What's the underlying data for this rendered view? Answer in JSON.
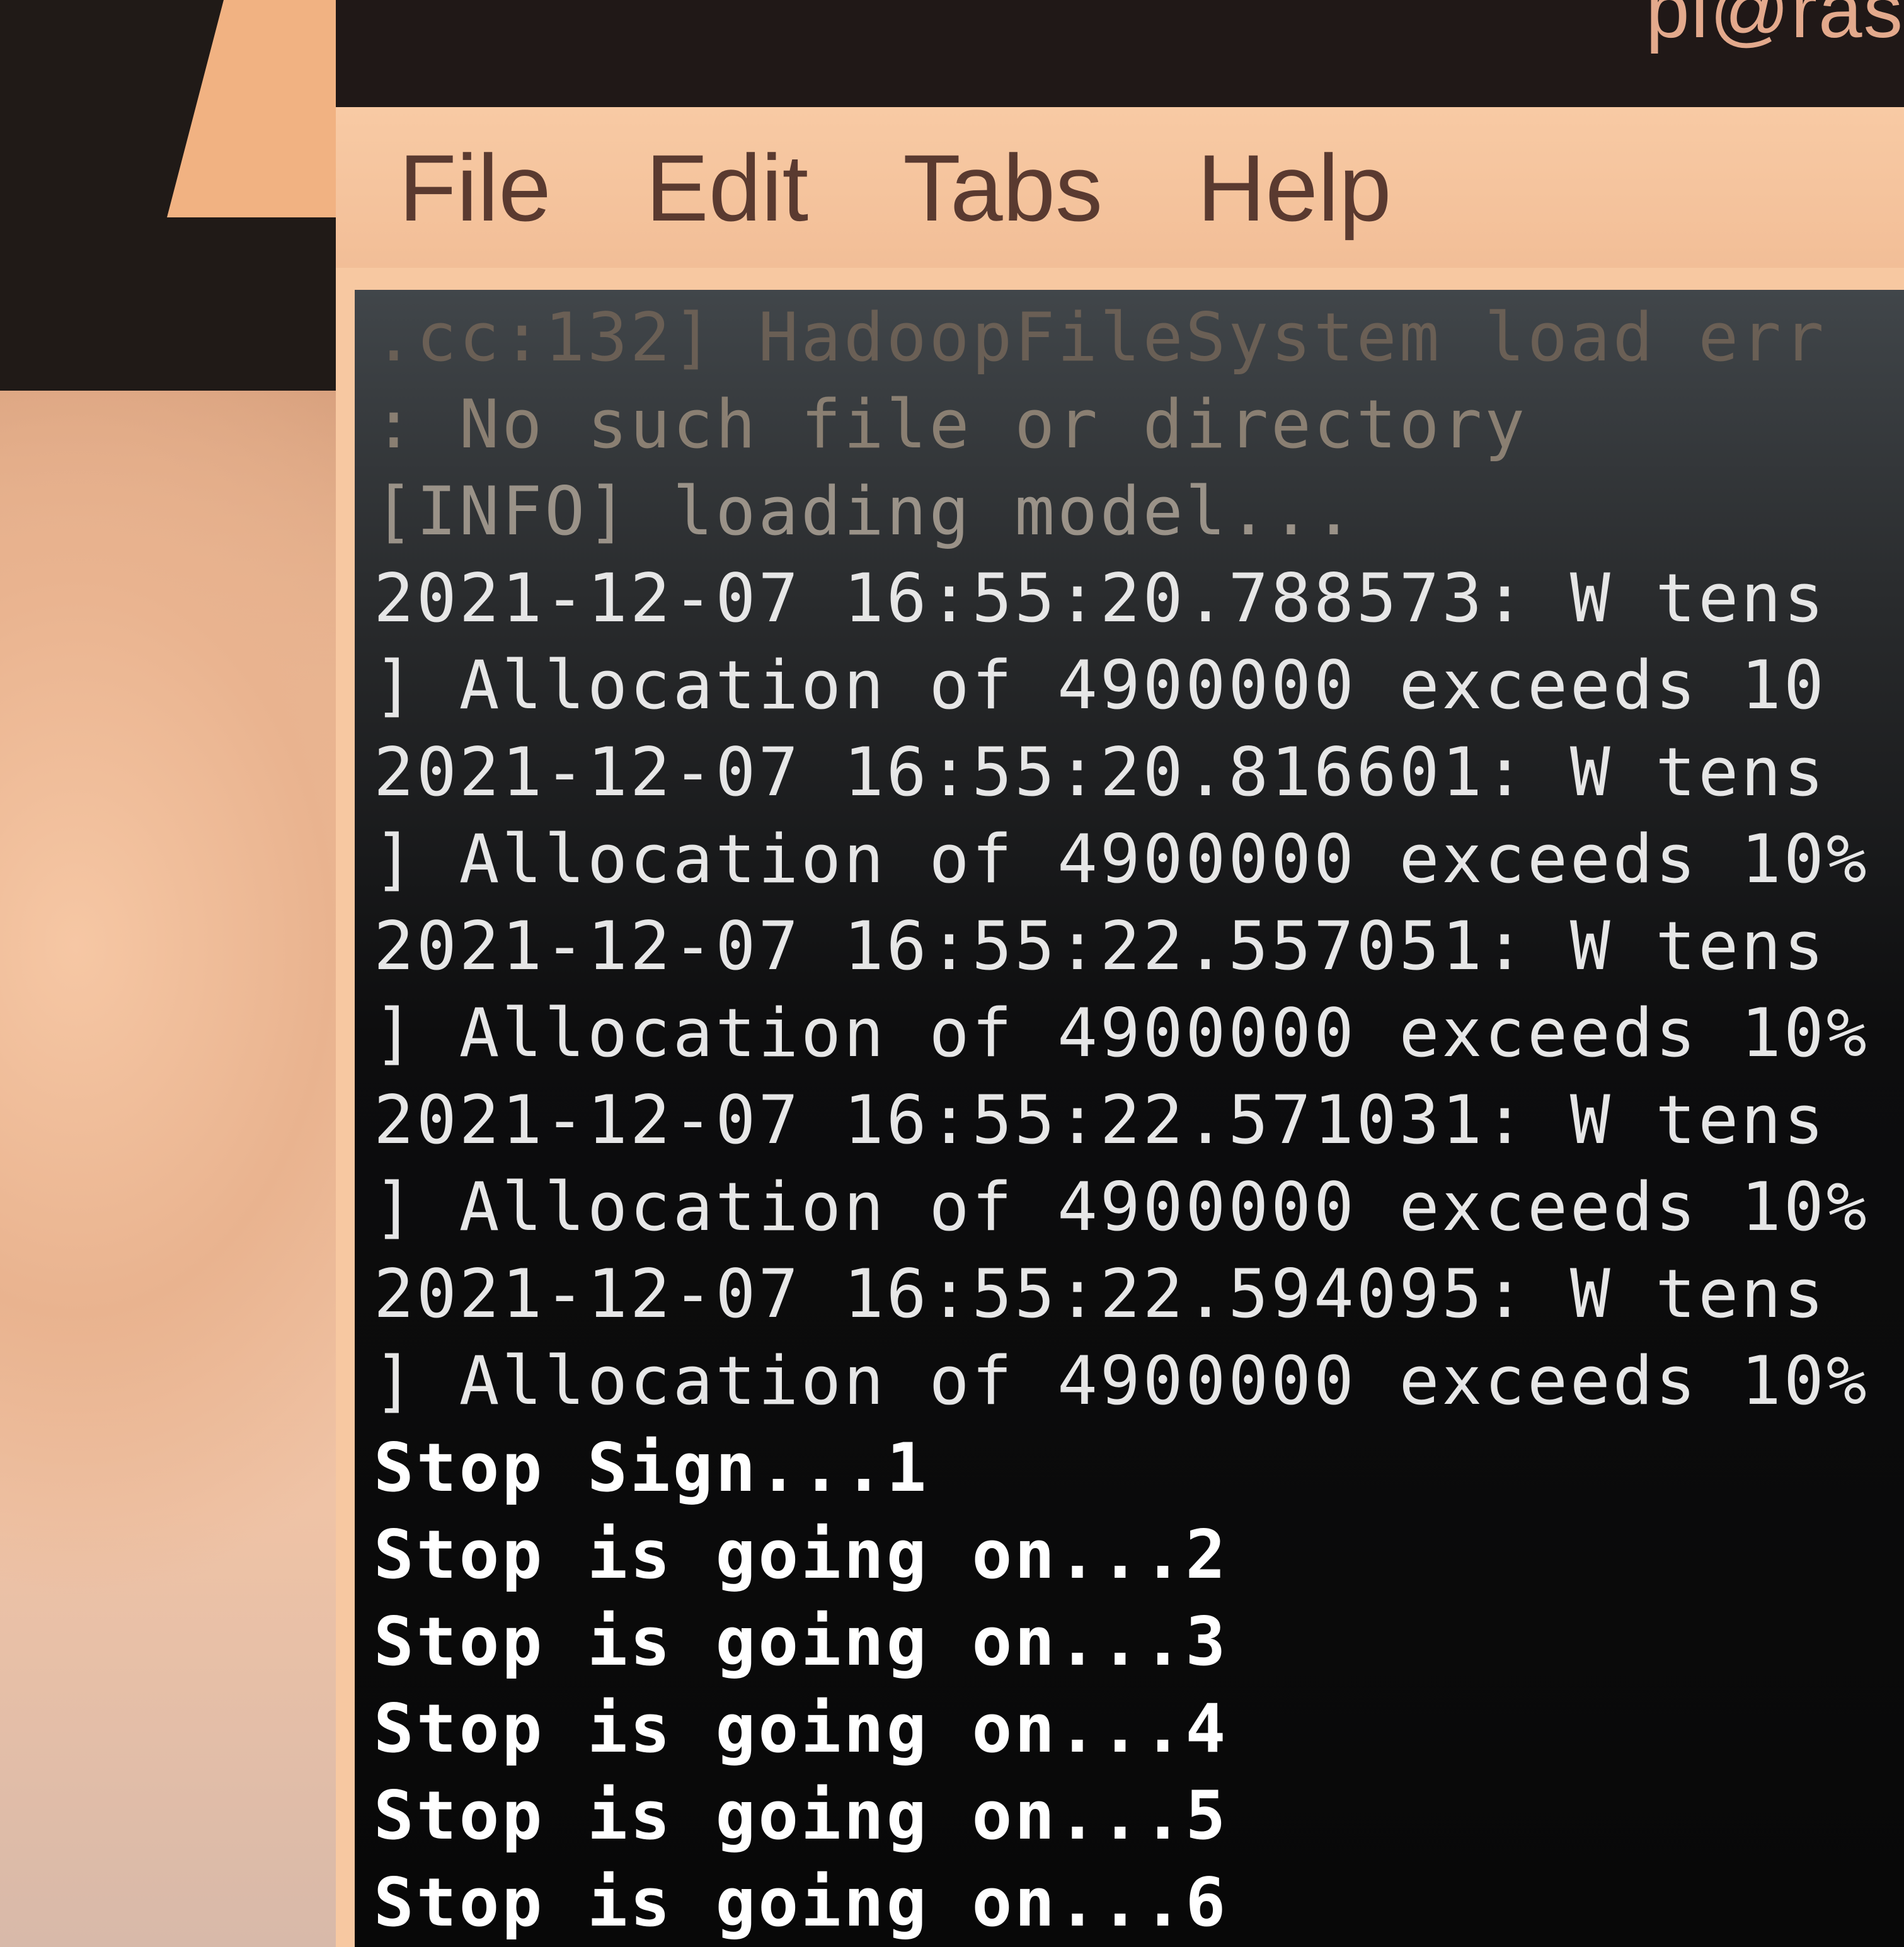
{
  "top_bar": {
    "label": "pi@ras"
  },
  "menubar": {
    "items": [
      "File",
      "Edit",
      "Tabs",
      "Help"
    ]
  },
  "terminal": {
    "lines": [
      ".cc:132] HadoopFileSystem load err",
      ": No such file or directory",
      "[INFO] loading model...",
      "2021-12-07 16:55:20.788573: W tens",
      "] Allocation of 4900000 exceeds 10",
      "2021-12-07 16:55:20.816601: W tens",
      "] Allocation of 4900000 exceeds 10%",
      "2021-12-07 16:55:22.557051: W tens",
      "] Allocation of 4900000 exceeds 10%",
      "2021-12-07 16:55:22.571031: W tens",
      "] Allocation of 4900000 exceeds 10%",
      "2021-12-07 16:55:22.594095: W tens",
      "] Allocation of 4900000 exceeds 10%",
      "Stop Sign...1",
      "Stop is going on...2",
      "Stop is going on...3",
      "Stop is going on...4",
      "Stop is going on...5",
      "Stop is going on...6"
    ]
  }
}
